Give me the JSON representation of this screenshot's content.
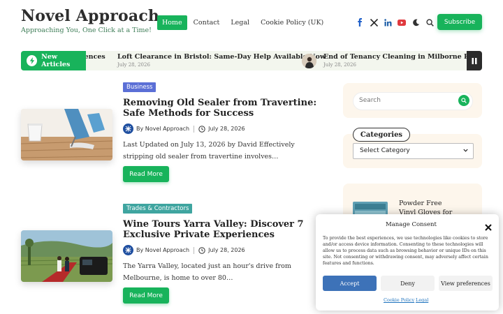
{
  "site": {
    "title": "Novel Approach",
    "tagline": "Approaching You, One Click at a Time!"
  },
  "nav": {
    "items": [
      {
        "label": "Home",
        "active": true
      },
      {
        "label": "Contact",
        "active": false
      },
      {
        "label": "Legal",
        "active": false
      },
      {
        "label": "Cookie Policy (UK)",
        "active": false
      }
    ]
  },
  "header_icons": [
    "facebook-icon",
    "x-icon",
    "linkedin-icon",
    "youtube-icon",
    "dark-mode-moon-icon",
    "search-icon"
  ],
  "subscribe_label": "Subscribe",
  "ticker": {
    "label": "New Articles",
    "items": [
      {
        "title": "riences",
        "date": ""
      },
      {
        "title": "Loft Clearance in Bristol: Same-Day Help Available Now",
        "date": "July 28, 2026"
      },
      {
        "title": "End of Tenancy Cleaning in Milborne Port for",
        "date": "July 28, 2026"
      }
    ]
  },
  "posts": [
    {
      "category": "Business",
      "category_color": "#5b6fd6",
      "title": "Removing Old Sealer from Travertine: Safe Methods for Success",
      "author": "By Novel Approach",
      "date": "July 28, 2026",
      "excerpt": "Last Updated on July 13, 2026 by David Effectively stripping old sealer from travertine involves…",
      "read_more": "Read More"
    },
    {
      "category": "Trades & Contractors",
      "category_color": "#3fa5a0",
      "title": "Wine Tours Yarra Valley: Discover 7 Exclusive Private Experiences",
      "author": "By Novel Approach",
      "date": "July 28, 2026",
      "excerpt": "The Yarra Valley, located just an hour's drive from Melbourne, is home to over 80…",
      "read_more": "Read More"
    }
  ],
  "sidebar": {
    "search_placeholder": "Search",
    "categories_title": "Categories",
    "categories_select": "Select Category",
    "recent_post_title": "Powder Free Vinyl Gloves for Luton"
  },
  "consent": {
    "title": "Manage Consent",
    "text": "To provide the best experiences, we use technologies like cookies to store and/or access device information. Consenting to these technologies will allow us to process data such as browsing behavior or unique IDs on this site. Not consenting or withdrawing consent, may adversely affect certain features and functions.",
    "accept": "Accept",
    "deny": "Deny",
    "preferences": "View preferences",
    "cookie_policy": "Cookie Policy",
    "legal": "Legal"
  },
  "colors": {
    "accent": "#18b35b",
    "widget_bg": "#fdf6ec",
    "ticker_bg": "#f3f6ee",
    "accept_blue": "#3d72b8"
  }
}
